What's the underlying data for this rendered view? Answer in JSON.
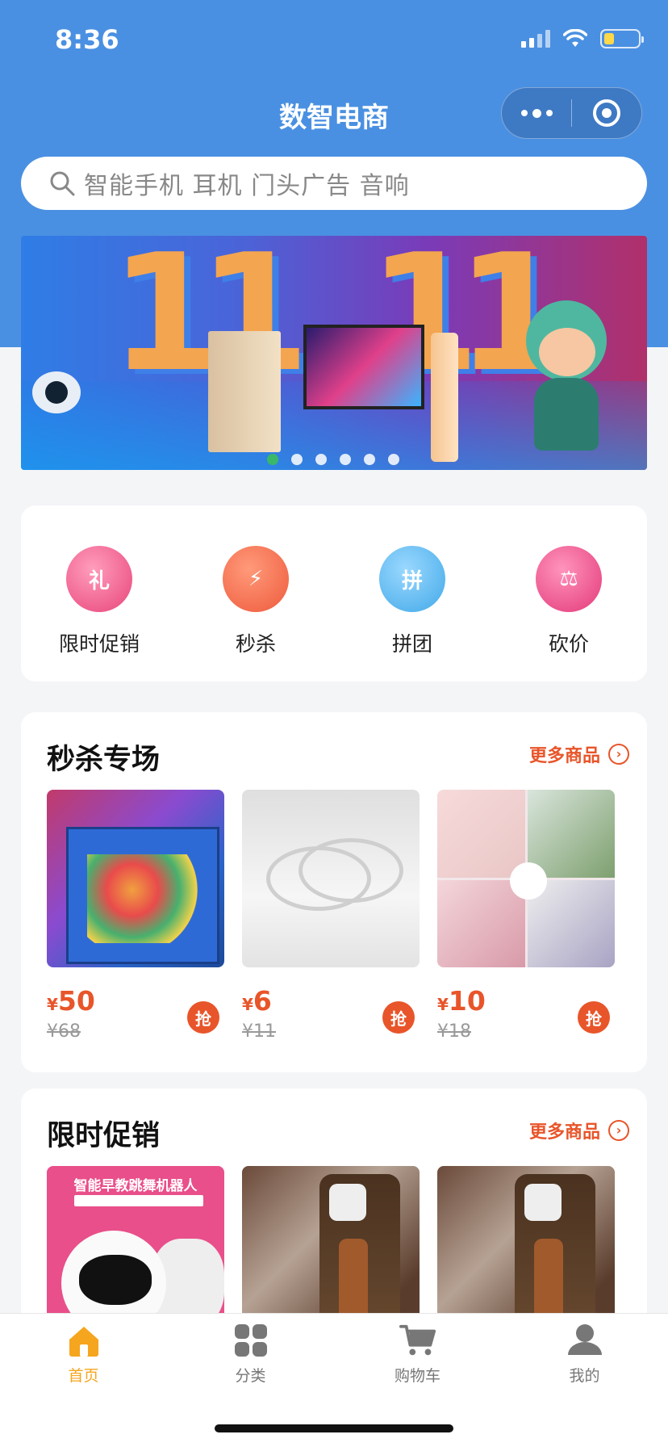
{
  "status_bar": {
    "time": "8:36"
  },
  "nav": {
    "title": "数智电商"
  },
  "search": {
    "placeholder": "智能手机  耳机  门头广告  音响"
  },
  "banner": {
    "big_text_left": "11",
    "big_text_right": "11",
    "active_slide": 0,
    "slide_count": 6
  },
  "quick_menu": [
    {
      "label": "限时促销",
      "icon": "gift-envelope-icon",
      "glyph": "礼",
      "color": "#e8457a"
    },
    {
      "label": "秒杀",
      "icon": "alarm-clock-icon",
      "glyph": "⚡",
      "color": "#ee5a3c"
    },
    {
      "label": "拼团",
      "icon": "group-buy-bag-icon",
      "glyph": "拼",
      "color": "#42a9e8"
    },
    {
      "label": "砍价",
      "icon": "gavel-icon",
      "glyph": "⚖",
      "color": "#e3397a"
    }
  ],
  "flash_sale": {
    "title": "秒杀专场",
    "more_label": "更多商品",
    "currency": "¥",
    "grab_label": "抢",
    "products": [
      {
        "price": "50",
        "original_price": "¥68",
        "image": "china-map-puzzle"
      },
      {
        "price": "6",
        "original_price": "¥11",
        "image": "silver-bracelet"
      },
      {
        "price": "10",
        "original_price": "¥18",
        "image": "nail-polish"
      }
    ]
  },
  "promotion": {
    "title": "限时促销",
    "more_label": "更多商品",
    "products": [
      {
        "image": "education-robot",
        "image_caption": "智能早教跳舞机器人"
      },
      {
        "image": "phone-case"
      },
      {
        "image": "phone-case"
      }
    ]
  },
  "tabbar": {
    "active": 0,
    "active_color": "#f5a51e",
    "items": [
      {
        "label": "首页",
        "icon": "home-icon"
      },
      {
        "label": "分类",
        "icon": "category-grid-icon"
      },
      {
        "label": "购物车",
        "icon": "cart-icon"
      },
      {
        "label": "我的",
        "icon": "profile-icon"
      }
    ]
  }
}
